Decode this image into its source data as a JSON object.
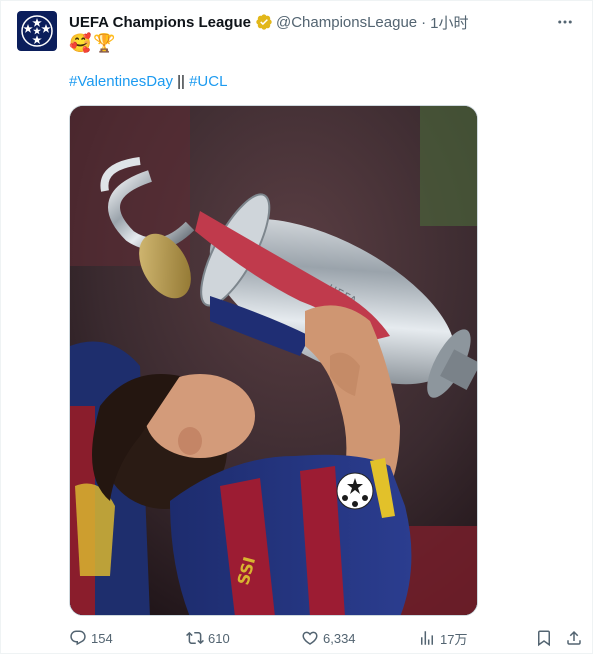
{
  "author": {
    "name": "UEFA Champions League",
    "handle": "@ChampionsLeague",
    "separator": "·",
    "time": "1小时"
  },
  "tweet": {
    "emojis": [
      "🥰",
      "🏆"
    ],
    "hashtag1": "#ValentinesDay",
    "separator": "||",
    "hashtag2": "#UCL"
  },
  "media": {
    "description_icon": "photo-player-kissing-trophy"
  },
  "actions": {
    "replies": "154",
    "retweets": "610",
    "likes": "6,334",
    "views": "17万"
  },
  "colors": {
    "link": "#1d9bf0",
    "muted": "#536471",
    "verified_gold": "#e2b719",
    "avatar_bg": "#0b1e5b"
  }
}
